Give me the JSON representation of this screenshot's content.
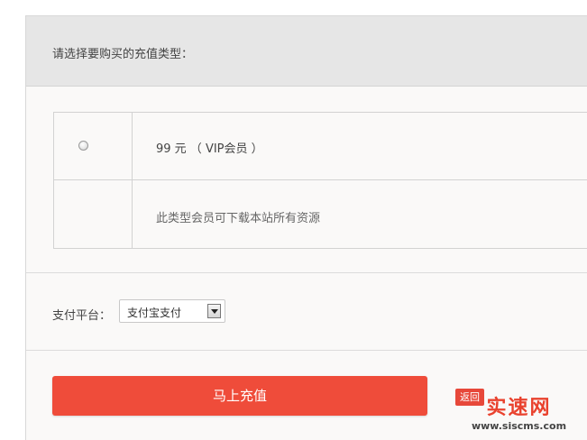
{
  "header": {
    "title": "请选择要购买的充值类型："
  },
  "plans": [
    {
      "selected": false,
      "label": "99 元 （ VIP会员 ）",
      "description": "此类型会员可下载本站所有资源"
    }
  ],
  "payment": {
    "label": "支付平台：",
    "selected_option": "支付宝支付"
  },
  "actions": {
    "submit_label": "马上充值",
    "back_label": "返回"
  },
  "watermark": {
    "name": "实速网",
    "url": "www.siscms.com"
  },
  "colors": {
    "accent": "#ef4c3a",
    "header_bg": "#e6e6e6",
    "panel_bg": "#faf9f8"
  }
}
